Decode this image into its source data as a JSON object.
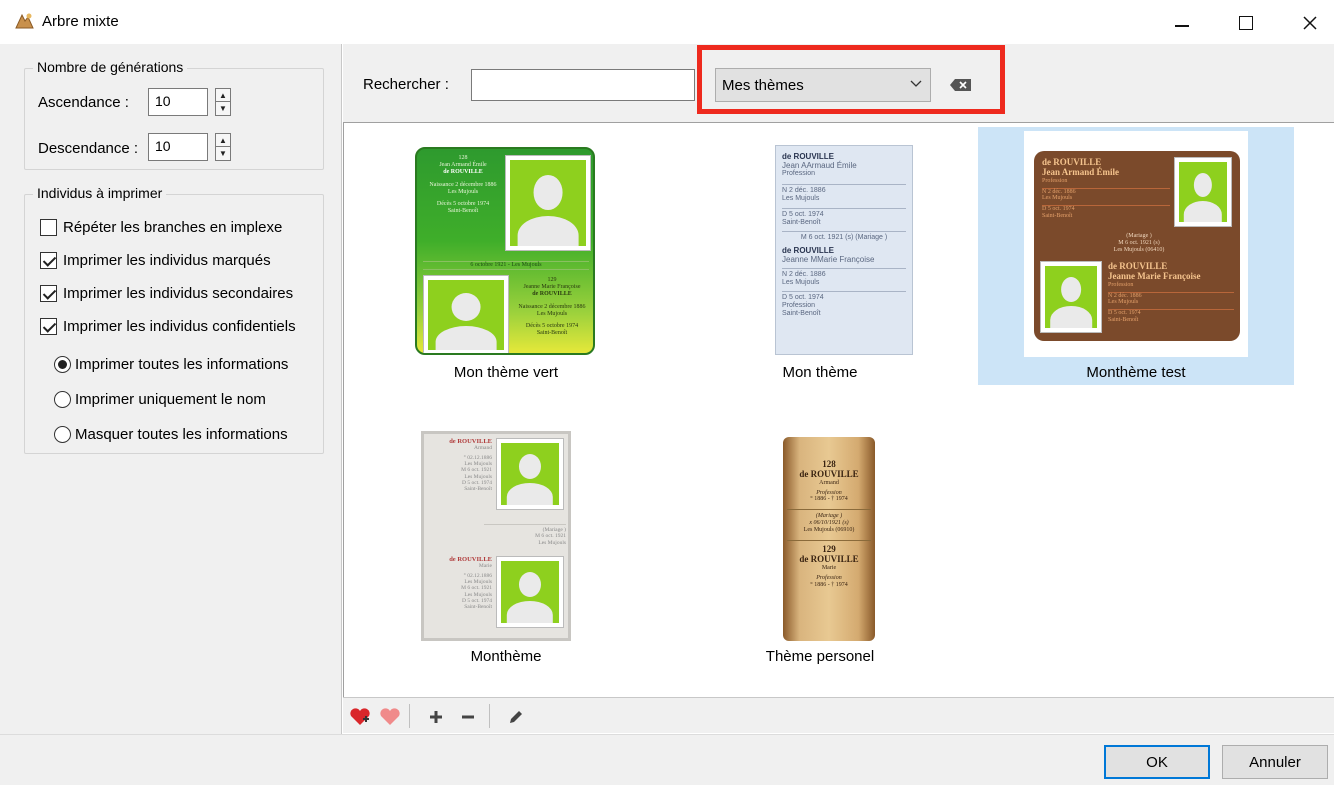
{
  "window": {
    "title": "Arbre mixte"
  },
  "generations": {
    "legend": "Nombre de générations",
    "ascendance_label": "Ascendance :",
    "ascendance_value": "10",
    "descendance_label": "Descendance :",
    "descendance_value": "10"
  },
  "individus": {
    "legend": "Individus à imprimer",
    "checks": [
      {
        "label": "Répéter les branches en implexe",
        "checked": false
      },
      {
        "label": "Imprimer les individus marqués",
        "checked": true
      },
      {
        "label": "Imprimer les individus secondaires",
        "checked": true
      },
      {
        "label": "Imprimer les individus confidentiels",
        "checked": true
      }
    ],
    "radios": [
      {
        "label": "Imprimer toutes les informations",
        "selected": true
      },
      {
        "label": "Imprimer uniquement le nom",
        "selected": false
      },
      {
        "label": "Masquer toutes les informations",
        "selected": false
      }
    ]
  },
  "search": {
    "label": "Rechercher :",
    "value": "",
    "theme_select": "Mes thèmes"
  },
  "themes": [
    {
      "label": "Mon thème vert",
      "selected": false,
      "card": {
        "top_num": "128",
        "top_line": "Jean Armand Émile",
        "top_name": "de ROUVILLE",
        "top_birth": "Naissance 2 décembre 1886",
        "top_birth_place": "Les Mujouls",
        "top_death": "Décès 5 octobre 1974",
        "top_death_place": "Saint-Benoît",
        "marriage": "6 octobre 1921 - Les Mujouls",
        "bottom_num": "129",
        "bottom_first": "Jeanne Marie Françoise",
        "bottom_name": "de ROUVILLE",
        "bottom_birth": "Naissance 2 décembre 1886",
        "bottom_birth_place": "Les Mujouls",
        "bottom_death": "Décès 5 octobre 1974",
        "bottom_death_place": "Saint-Benoît"
      }
    },
    {
      "label": "Mon thème",
      "selected": false,
      "card": {
        "name1": "de ROUVILLE",
        "first1": "Jean AArmaud Émile",
        "prof1": "Profession",
        "birth1": "N 2 déc. 1886",
        "birth1_place": "Les Mujouls",
        "death1": "D 5 oct. 1974",
        "death1_place": "Saint-Benoît",
        "marriage": "M 6 oct. 1921 (s) (Mariage )",
        "name2": "de ROUVILLE",
        "first2": "Jeanne MMarie Françoise",
        "birth2": "N 2 déc. 1886",
        "birth2_place": "Les Mujouls",
        "death2": "D 5 oct. 1974",
        "prof2": "Profession",
        "death2_place": "Saint-Benoît"
      }
    },
    {
      "label": "Monthème test",
      "selected": true,
      "card": {
        "name1": "de ROUVILLE",
        "first1": "Jean Armand Émile",
        "prof1": "Profession",
        "birth1": "N 2 déc. 1886",
        "birth1_place": "Les Mujouls",
        "death1": "D 5 oct. 1974",
        "death1_place": "Saint-Benoît",
        "marriage1": "(Mariage )",
        "marriage2": "M 6 oct. 1921 (s)",
        "marriage3": "Les Mujouls (06410)",
        "name2": "de ROUVILLE",
        "first2": "Jeanne Marie Françoise",
        "prof2": "Profession",
        "birth2": "N 2 déc. 1886",
        "birth2_place": "Les Mujouls",
        "death2": "D 5 oct. 1974",
        "death2_place": "Saint-Benoît"
      }
    },
    {
      "label": "Monthème",
      "selected": false,
      "card": {
        "name1": "de ROUVILLE",
        "first1": "Armand",
        "birth1": "° 02.12.1886",
        "birth1_place": "Les Mujouls",
        "marriage_a": "M 6 oct. 1921",
        "marriage_b": "Les Mujouls",
        "death1": "D 5 oct. 1974",
        "death1_place": "Saint-Benoît",
        "marriage": "(Mariage )",
        "marriage_date": "M 6 oct. 1921",
        "marriage_place": "Les Mujouls",
        "name2": "de ROUVILLE",
        "first2": "Marie",
        "birth2": "° 02.12.1886",
        "birth2_place": "Les Mujouls",
        "marr2a": "M 6 oct. 1921",
        "marr2b": "Les Mujouls",
        "death2": "D 5 oct. 1974",
        "death2_place": "Saint-Benoît"
      }
    },
    {
      "label": "Thème personel",
      "selected": false,
      "card": {
        "num1": "128",
        "name1": "de ROUVILLE",
        "first1": "Armand",
        "prof1": "Profession",
        "dates1": "° 1886 - † 1974",
        "marriage": "(Mariage )",
        "marriage_date": "x 06/10/1921 (s)",
        "marriage_place": "Les Mujouls (06910)",
        "num2": "129",
        "name2": "de ROUVILLE",
        "first2": "Marie",
        "prof2": "Profession",
        "dates2": "° 1886 - † 1974"
      }
    }
  ],
  "footer": {
    "ok": "OK",
    "cancel": "Annuler"
  },
  "colors": {
    "highlight": "#ee2a1e",
    "selection": "#cce4f7",
    "ok_border": "#0078d7",
    "green_theme": "#3fae2a",
    "brown_theme": "#7b4a2b"
  },
  "icons": [
    "app-icon",
    "minimize-icon",
    "maximize-icon",
    "close-icon",
    "clear-search-icon",
    "heart-add-icon",
    "heart-remove-icon",
    "plus-icon",
    "minus-icon",
    "pencil-icon"
  ]
}
